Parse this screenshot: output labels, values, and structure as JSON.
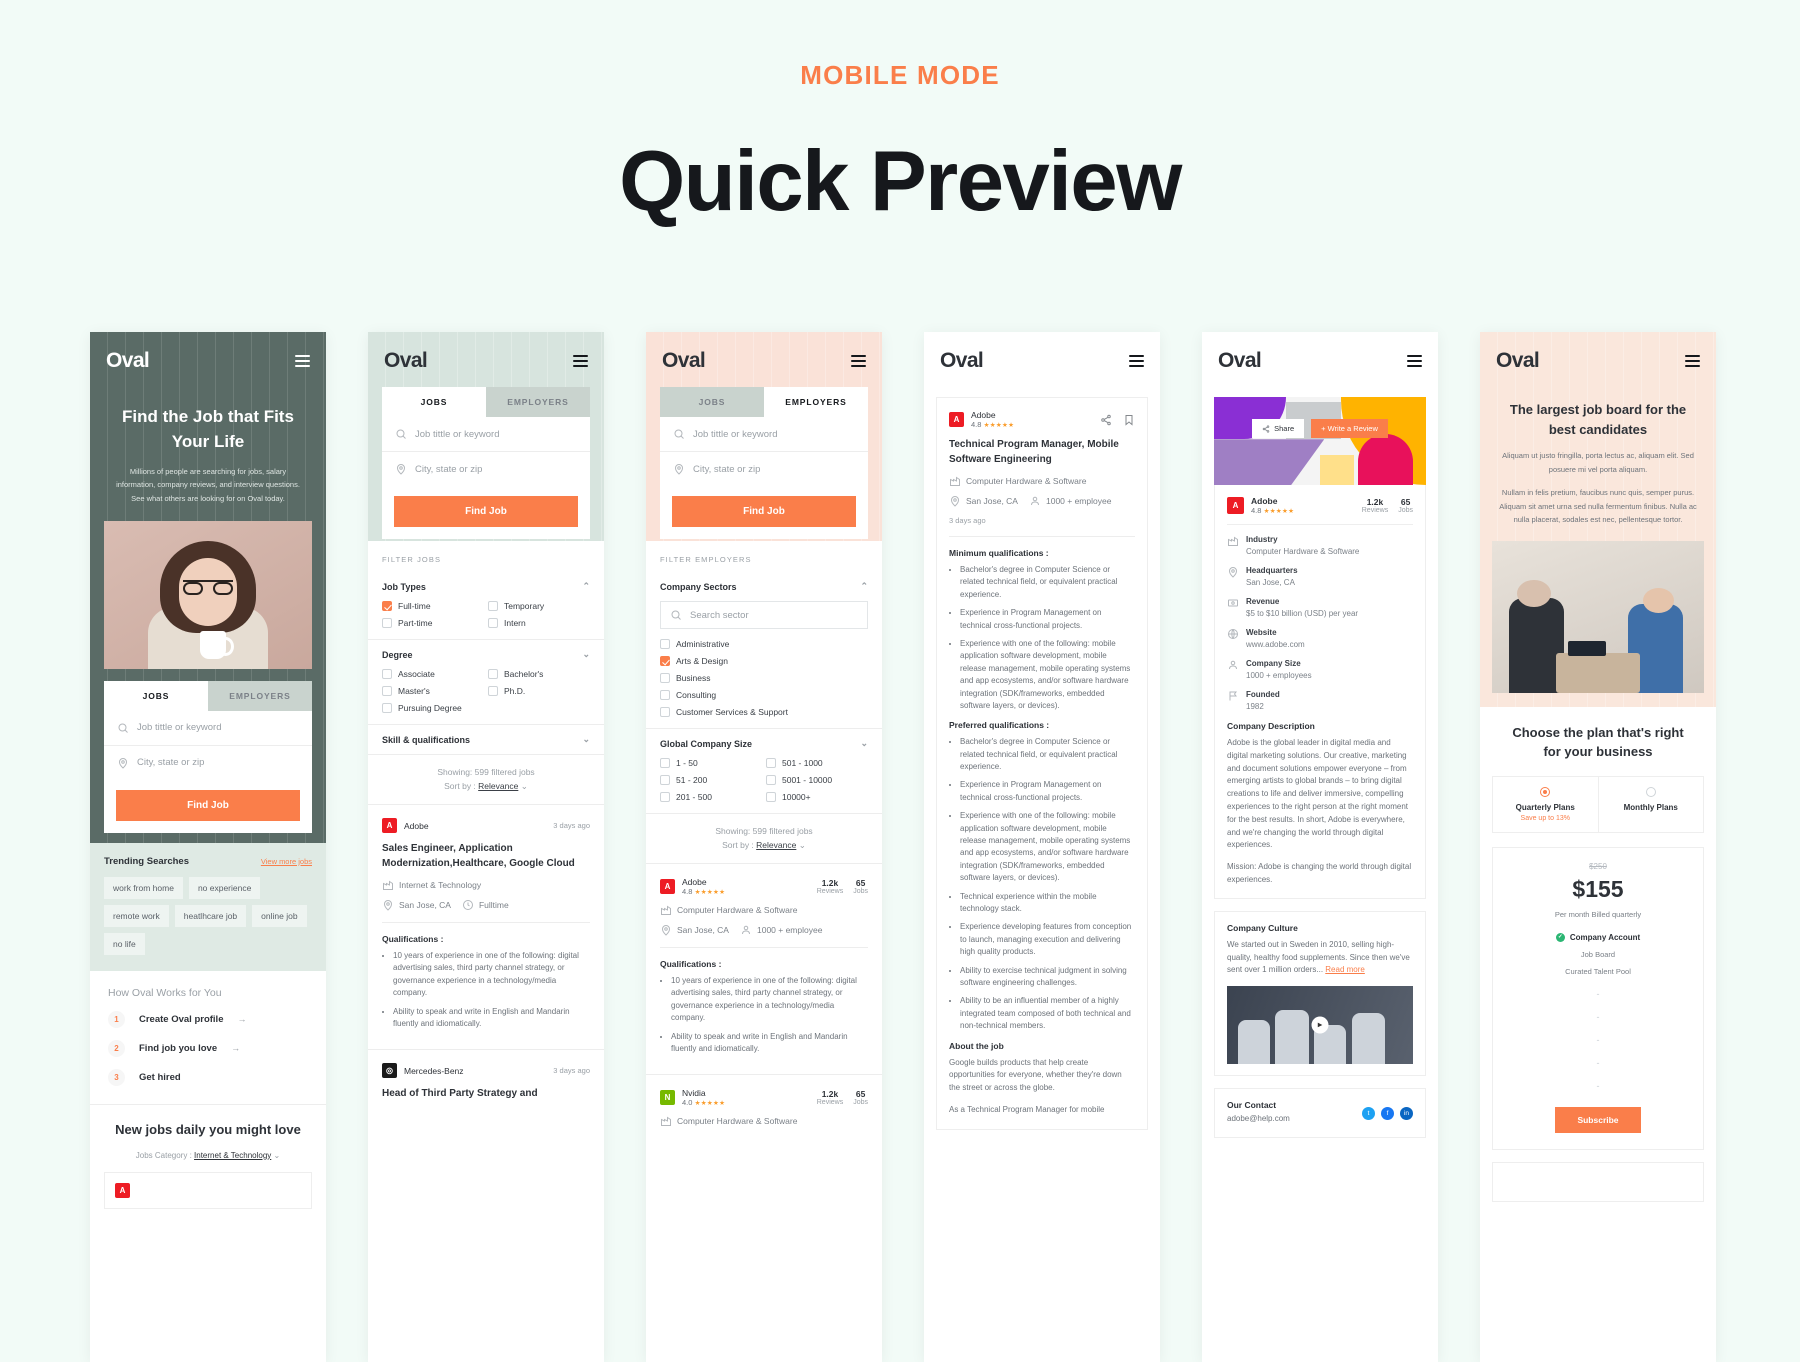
{
  "header": {
    "eyebrow": "MOBILE MODE",
    "title": "Quick Preview"
  },
  "brand": {
    "name": "Oval",
    "accent": "#fa7e4a",
    "dark": "#5a6b66"
  },
  "common": {
    "tab_jobs": "JOBS",
    "tab_employers": "EMPLOYERS",
    "search_job_placeholder": "Job tittle or keyword",
    "search_loc_placeholder": "City, state or zip",
    "find_job": "Find Job",
    "search_icon": "search-icon",
    "pin_icon": "location-pin-icon",
    "menu_icon": "hamburger-menu-icon"
  },
  "screen1": {
    "hero_title": "Find the Job that Fits Your Life",
    "hero_body": "Millions of people are searching for jobs, salary information, company reviews, and interview questions. See what others are looking for on Oval today.",
    "trending_title": "Trending Searches",
    "trending_view_more": "View more jobs",
    "chips": [
      "work from home",
      "no experience",
      "remote work",
      "heatlhcare job",
      "online job",
      "no life"
    ],
    "works_title": "How Oval Works for You",
    "steps": [
      {
        "num": "1",
        "label": "Create Oval profile"
      },
      {
        "num": "2",
        "label": "Find job you love"
      },
      {
        "num": "3",
        "label": "Get hired"
      }
    ],
    "newjobs_title": "New jobs daily you might love",
    "category_label": "Jobs Category :",
    "category_value": "Internet & Technology"
  },
  "screen2": {
    "filter_label": "FILTER JOBS",
    "groups": [
      {
        "title": "Job Types",
        "items": [
          {
            "label": "Full-time",
            "checked": true
          },
          {
            "label": "Temporary",
            "checked": false
          },
          {
            "label": "Part-time",
            "checked": false
          },
          {
            "label": "Intern",
            "checked": false
          }
        ]
      },
      {
        "title": "Degree",
        "items": [
          {
            "label": "Associate",
            "checked": false
          },
          {
            "label": "Bachelor's",
            "checked": false
          },
          {
            "label": "Master's",
            "checked": false
          },
          {
            "label": "Ph.D.",
            "checked": false
          },
          {
            "label": "Pursuing Degree",
            "checked": false
          }
        ]
      }
    ],
    "skills_title": "Skill & qualifications",
    "showing": "Showing: 599 filtered jobs",
    "sort_prefix": "Sort by :",
    "sort_value": "Relevance",
    "job1": {
      "company": "Adobe",
      "ago": "3 days ago",
      "title": "Sales Engineer, Application Modernization,Healthcare, Google Cloud",
      "sector": "Internet & Technology",
      "location": "San Jose, CA",
      "type": "Fulltime",
      "qual_title": "Qualifications :",
      "quals": [
        "10 years of experience in one of the following: digital advertising sales, third party channel strategy, or governance experience in a technology/media company.",
        "Ability to speak and write in English and Mandarin fluently and idiomatically."
      ]
    },
    "job2": {
      "company": "Mercedes-Benz",
      "ago": "3 days ago",
      "title": "Head of Third Party Strategy and"
    }
  },
  "screen3": {
    "filter_label": "FILTER EMPLOYERS",
    "sectors_title": "Company Sectors",
    "sector_search_placeholder": "Search sector",
    "sectors": [
      {
        "label": "Administrative",
        "checked": false
      },
      {
        "label": "Arts & Design",
        "checked": true
      },
      {
        "label": "Business",
        "checked": false
      },
      {
        "label": "Consulting",
        "checked": false
      },
      {
        "label": "Customer Services & Support",
        "checked": false
      }
    ],
    "size_title": "Global Company Size",
    "sizes": [
      {
        "label": "1 - 50",
        "checked": false
      },
      {
        "label": "501 - 1000",
        "checked": false
      },
      {
        "label": "51 - 200",
        "checked": false
      },
      {
        "label": "5001 - 10000",
        "checked": false
      },
      {
        "label": "201 - 500",
        "checked": false
      },
      {
        "label": "10000+",
        "checked": false
      }
    ],
    "showing": "Showing: 599 filtered jobs",
    "sort_prefix": "Sort by :",
    "sort_value": "Relevance",
    "emp1": {
      "company": "Adobe",
      "rating": "4.8",
      "stars": "★★★★★",
      "reviews_num": "1.2k",
      "reviews_lbl": "Reviews",
      "jobs_num": "65",
      "jobs_lbl": "Jobs",
      "sector": "Computer Hardware & Software",
      "location": "San Jose, CA",
      "size": "1000 + employee",
      "qual_title": "Qualifications :",
      "quals": [
        "10 years of experience in one of the following: digital advertising sales, third party channel strategy, or governance experience in a technology/media company.",
        "Ability to speak and write in English and Mandarin fluently and idiomatically."
      ]
    },
    "emp2": {
      "company": "Nvidia",
      "rating": "4.0",
      "stars": "★★★★★",
      "reviews_num": "1.2k",
      "reviews_lbl": "Reviews",
      "jobs_num": "65",
      "jobs_lbl": "Jobs",
      "sector": "Computer Hardware & Software"
    }
  },
  "screen4": {
    "company": "Adobe",
    "rating": "4.8",
    "stars": "★★★★★",
    "share_icon": "share-icon",
    "bookmark_icon": "bookmark-icon",
    "title": "Technical Program Manager, Mobile Software Engineering",
    "sector": "Computer Hardware & Software",
    "location": "San Jose, CA",
    "size": "1000 + employee",
    "ago": "3 days ago",
    "min_title": "Minimum qualifications :",
    "min_quals": [
      "Bachelor's degree in Computer Science or related technical field, or equivalent practical experience.",
      "Experience in Program Management on technical cross-functional projects.",
      "Experience with one of the following: mobile application software development, mobile release management, mobile operating systems and app ecosystems, and/or software hardware integration (SDK/frameworks, embedded software layers, or devices)."
    ],
    "pref_title": "Preferred qualifications :",
    "pref_quals": [
      "Bachelor's degree in Computer Science or related technical field, or equivalent practical experience.",
      "Experience in Program Management on technical cross-functional projects.",
      "Experience with one of the following: mobile application software development, mobile release management, mobile operating systems and app ecosystems, and/or software hardware integration (SDK/frameworks, embedded software layers, or devices).",
      "Technical experience within the mobile technology stack.",
      "Experience developing features from conception to launch, managing execution and delivering high quality products.",
      "Ability to exercise technical judgment in solving software engineering challenges.",
      "Ability to be an influential member of a highly integrated team composed of both technical and non-technical members."
    ],
    "about_title": "About the job",
    "about_body": "Google builds products that help create opportunities for everyone, whether they're down the street or across the globe.",
    "about_body2": "As a Technical Program Manager for mobile"
  },
  "screen5": {
    "share_label": "Share",
    "review_label": "+ Write a Review",
    "company": "Adobe",
    "rating": "4.8",
    "stars": "★★★★★",
    "reviews_num": "1.2k",
    "reviews_lbl": "Reviews",
    "jobs_num": "65",
    "jobs_lbl": "Jobs",
    "info": [
      {
        "icon": "industry-icon",
        "label": "Industry",
        "value": "Computer Hardware & Software"
      },
      {
        "icon": "location-pin-icon",
        "label": "Headquarters",
        "value": "San Jose, CA"
      },
      {
        "icon": "revenue-icon",
        "label": "Revenue",
        "value": "$5 to $10 billion (USD) per year"
      },
      {
        "icon": "globe-icon",
        "label": "Website",
        "value": "www.adobe.com"
      },
      {
        "icon": "people-icon",
        "label": "Company Size",
        "value": "1000 + employees"
      },
      {
        "icon": "flag-icon",
        "label": "Founded",
        "value": "1982"
      }
    ],
    "desc_title": "Company Description",
    "desc_body": "Adobe is the global leader in digital media and digital marketing solutions. Our creative, marketing and document solutions empower everyone – from emerging artists to global brands – to bring digital creations to life and deliver immersive, compelling experiences to the right person at the right moment for the best results. In short, Adobe is everywhere, and we're changing the world through digital experiences.",
    "mission": "Mission: Adobe is changing the world through digital experiences.",
    "culture_title": "Company Culture",
    "culture_body": "We started out in Sweden in 2010, selling high-quality, healthy food supplements. Since then we've sent over 1 million orders...",
    "read_more": "Read more",
    "play_icon": "play-icon",
    "contact_title": "Our Contact",
    "contact_email": "adobe@help.com",
    "socials": [
      "twitter-icon",
      "facebook-icon",
      "linkedin-icon"
    ]
  },
  "screen6": {
    "title": "The largest job board for the  best candidates",
    "body1": "Aliquam ut justo fringilla, porta lectus ac, aliquam elit. Sed posuere mi vel porta aliquam.",
    "body2": "Nullam in felis pretium, faucibus nunc quis, semper purus. Aliquam sit amet urna sed nulla fermentum finibus. Nulla ac nulla placerat, sodales est nec, pellentesque tortor.",
    "plan_title": "Choose the plan that's right for your business",
    "toggle_quarterly": "Quarterly Plans",
    "toggle_quarterly_sub": "Save up to 13%",
    "toggle_monthly": "Monthly Plans",
    "old_price": "$250",
    "price": "$155",
    "price_sub": "Per month Billed quarterly",
    "feature_title": "Company Account",
    "features": [
      "Job Board",
      "Curated Talent Pool"
    ],
    "subscribe": "Subscribe"
  }
}
